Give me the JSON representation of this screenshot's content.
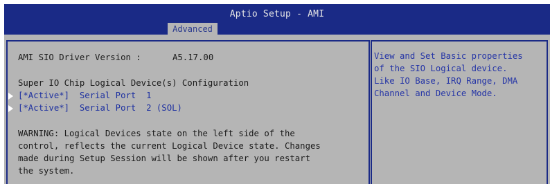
{
  "header": {
    "title": "Aptio Setup - AMI",
    "active_tab": "Advanced"
  },
  "main": {
    "driver_version_label": "AMI SIO Driver Version :",
    "driver_version_value": "A5.17.00",
    "section_title": "Super IO Chip Logical Device(s) Configuration",
    "devices": [
      {
        "label": "[*Active*]  Serial Port  1"
      },
      {
        "label": "[*Active*]  Serial Port  2 (SOL)"
      }
    ],
    "warning": [
      "WARNING: Logical Devices state on the left side of the",
      "control, reflects the current Logical Device state. Changes",
      "made during Setup Session will be shown after you restart",
      "the system."
    ]
  },
  "help_panel": {
    "lines": [
      "View and Set Basic properties",
      "of the SIO Logical device.",
      "Like IO Base, IRQ Range, DMA",
      "Channel and Device Mode."
    ]
  },
  "colors": {
    "header_bg": "#1a2a86",
    "panel_bg": "#b5b5b5",
    "link_text": "#1c2fa0",
    "help_text": "#2535a6"
  }
}
